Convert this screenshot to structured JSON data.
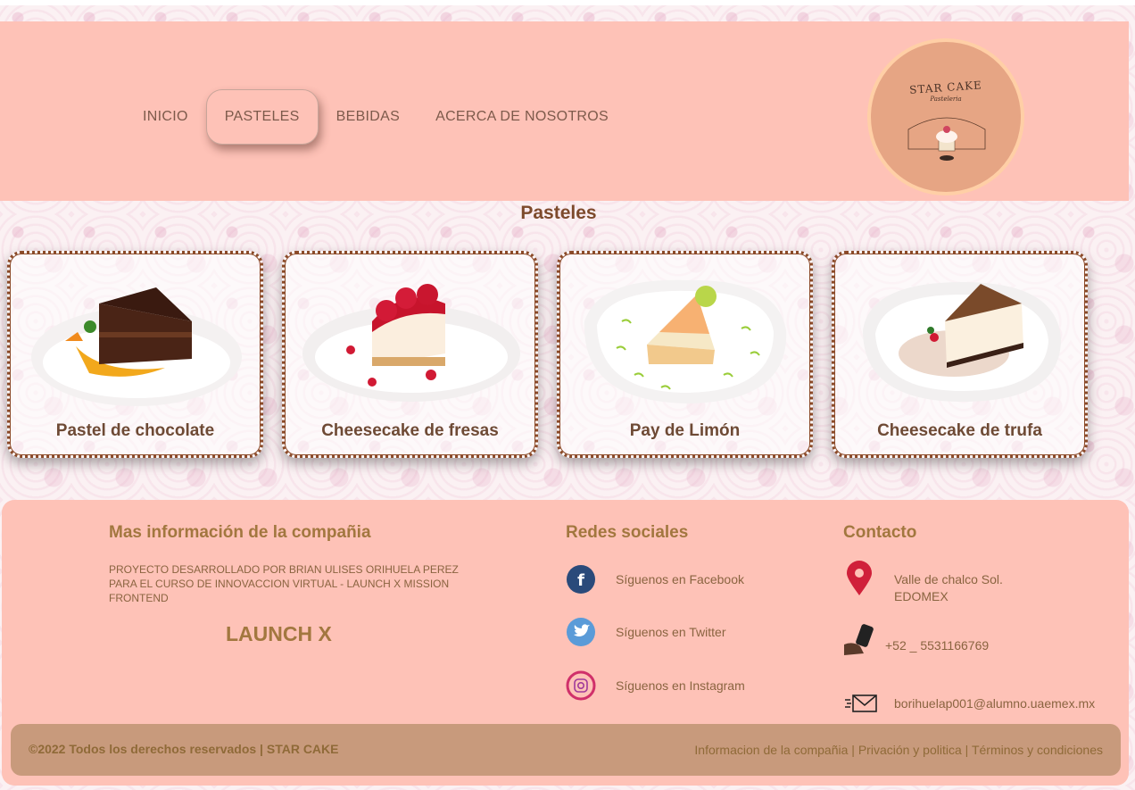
{
  "nav": {
    "items": [
      {
        "label": "INICIO"
      },
      {
        "label": "PASTELES"
      },
      {
        "label": "BEBIDAS"
      },
      {
        "label": "ACERCA DE NOSOTROS"
      }
    ]
  },
  "logo": {
    "name": "STAR CAKE",
    "sub": "Pasteleria"
  },
  "section": {
    "title": "Pasteles"
  },
  "cards": [
    {
      "label": "Pastel de chocolate"
    },
    {
      "label": "Cheesecake de fresas"
    },
    {
      "label": "Pay de Limón"
    },
    {
      "label": "Cheesecake de trufa"
    }
  ],
  "footer": {
    "info_title": "Mas información de la compañia",
    "info_text": "PROYECTO DESARROLLADO POR BRIAN ULISES ORIHUELA PEREZ PARA EL CURSO DE INNOVACCION VIRTUAL - LAUNCH X MISSION FRONTEND",
    "launch": "LAUNCH X",
    "social_title": "Redes sociales",
    "social": [
      {
        "label": "Síguenos en Facebook"
      },
      {
        "label": "Síguenos en Twitter"
      },
      {
        "label": "Síguenos en Instagram"
      }
    ],
    "contact_title": "Contacto",
    "address_line1": "Valle de chalco Sol.",
    "address_line2": "EDOMEX",
    "phone": "+52 _ 5531166769",
    "email": "borihuelap001@alumno.uaemex.mx",
    "copyright": "©2022 Todos los derechos reservados | STAR CAKE",
    "link_info": "Informacion de la compañia",
    "link_privacy": "Privación y politica",
    "link_terms": "Términos y condiciones",
    "sep": "|"
  },
  "colors": {
    "header_bg": "#fec2b7",
    "accent": "#a2773f",
    "card_border": "#8b4a28"
  }
}
